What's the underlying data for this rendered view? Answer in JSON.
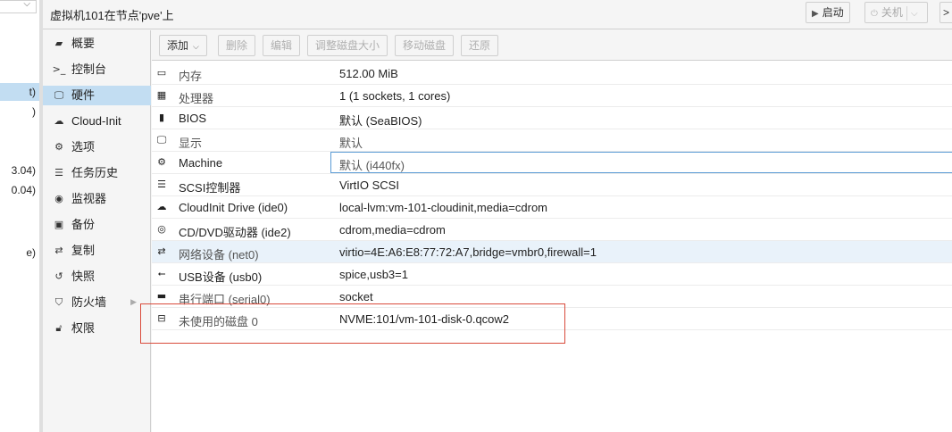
{
  "tree": {
    "items": [
      {
        "text": "t)",
        "selected": true
      },
      {
        "text": ")",
        "selected": false
      },
      {
        "text": "3.04)",
        "selected": false
      },
      {
        "text": "0.04)",
        "selected": false
      },
      {
        "text": "e)",
        "selected": false
      }
    ]
  },
  "header": {
    "title": "虚拟机101在节点'pve'上",
    "start_label": "启动",
    "shutdown_label": "关机",
    "more_label": ">"
  },
  "nav": {
    "items": [
      {
        "label": "概要",
        "icon": "book-icon"
      },
      {
        "label": "控制台",
        "icon": "terminal-icon"
      },
      {
        "label": "硬件",
        "icon": "monitor-icon",
        "active": true
      },
      {
        "label": "Cloud-Init",
        "icon": "cloud-icon"
      },
      {
        "label": "选项",
        "icon": "gear-icon"
      },
      {
        "label": "任务历史",
        "icon": "list-icon"
      },
      {
        "label": "监视器",
        "icon": "eye-icon"
      },
      {
        "label": "备份",
        "icon": "floppy-icon"
      },
      {
        "label": "复制",
        "icon": "retweet-icon"
      },
      {
        "label": "快照",
        "icon": "history-icon"
      },
      {
        "label": "防火墙",
        "icon": "shield-icon",
        "has_submenu": true
      },
      {
        "label": "权限",
        "icon": "unlock-icon"
      }
    ]
  },
  "toolbar": {
    "add": "添加",
    "remove": "删除",
    "edit": "编辑",
    "resize": "调整磁盘大小",
    "move": "移动磁盘",
    "revert": "还原"
  },
  "hardware": {
    "rows": [
      {
        "icon": "memory-icon",
        "key": "内存",
        "value": "512.00 MiB"
      },
      {
        "icon": "cpu-icon",
        "key": "处理器",
        "value": "1 (1 sockets, 1 cores)"
      },
      {
        "icon": "bios-icon",
        "key": "BIOS",
        "value": "默认 (SeaBIOS)"
      },
      {
        "icon": "display-icon",
        "key": "显示",
        "value": "默认"
      },
      {
        "icon": "machine-icon",
        "key": "Machine",
        "value": "默认 (i440fx)"
      },
      {
        "icon": "database-icon",
        "key": "SCSI控制器",
        "value": "VirtIO SCSI"
      },
      {
        "icon": "cloud-icon",
        "key": "CloudInit Drive (ide0)",
        "value": "local-lvm:vm-101-cloudinit,media=cdrom"
      },
      {
        "icon": "cdrom-icon",
        "key": "CD/DVD驱动器 (ide2)",
        "value": "cdrom,media=cdrom"
      },
      {
        "icon": "network-icon",
        "key": "网络设备 (net0)",
        "value": "virtio=4E:A6:E8:77:72:A7,bridge=vmbr0,firewall=1"
      },
      {
        "icon": "usb-icon",
        "key": "USB设备 (usb0)",
        "value": "spice,usb3=1"
      },
      {
        "icon": "serial-icon",
        "key": "串行端口 (serial0)",
        "value": "socket"
      },
      {
        "icon": "hdd-icon",
        "key": "未使用的磁盘 0",
        "value": "NVME:101/vm-101-disk-0.qcow2"
      }
    ]
  }
}
